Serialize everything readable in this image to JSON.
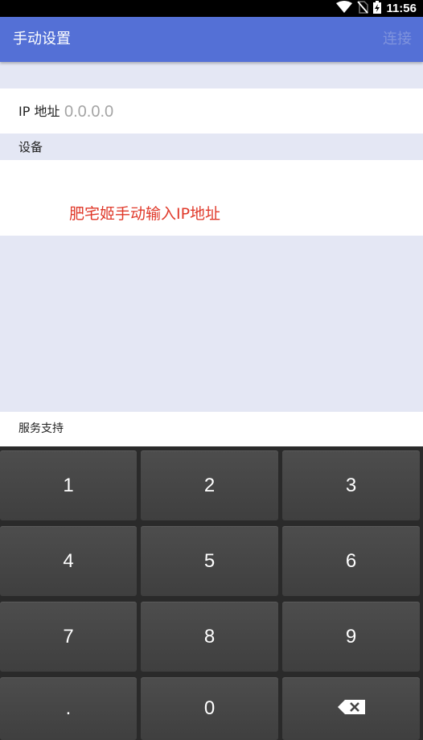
{
  "status_bar": {
    "time": "11:56",
    "icons": [
      "wifi-icon",
      "no-sim-icon",
      "battery-charging-icon"
    ]
  },
  "app_bar": {
    "title": "手动设置",
    "action": "连接"
  },
  "ip_field": {
    "label": "IP 地址",
    "placeholder": "0.0.0.0"
  },
  "device_section": {
    "title": "设备",
    "notice": "肥宅姬手动输入IP地址"
  },
  "service_section": {
    "label": "服务支持"
  },
  "keyboard": {
    "keys": [
      "1",
      "2",
      "3",
      "4",
      "5",
      "6",
      "7",
      "8",
      "9",
      ".",
      "0"
    ],
    "backspace_icon": "backspace-icon"
  },
  "colors": {
    "app_bar": "#5470d6",
    "action_disabled": "#7f93dd",
    "background": "#e4e7f4",
    "notice": "#e0392a",
    "keyboard": "#2a2a2a",
    "key": "#464646"
  }
}
